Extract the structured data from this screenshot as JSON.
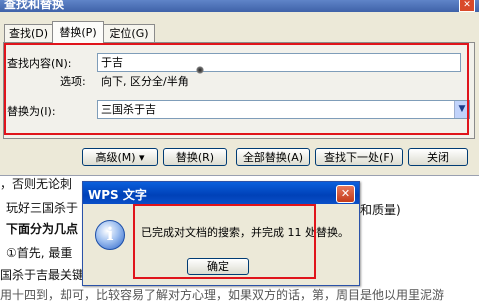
{
  "main_dialog": {
    "title": "查找和替换",
    "tabs": [
      {
        "label": "查找(D)"
      },
      {
        "label": "替换(P)"
      },
      {
        "label": "定位(G)"
      }
    ],
    "find": {
      "label": "查找内容(N):",
      "value": "于吉"
    },
    "options": {
      "label": "选项:",
      "value": "向下, 区分全/半角"
    },
    "replace": {
      "label": "替换为(I):",
      "value": "三国杀于吉"
    },
    "buttons": {
      "more": "高级(M) ▾",
      "replace": "替换(R)",
      "replace_all": "全部替换(A)",
      "find_next": "查找下一处(F)",
      "close": "关闭"
    }
  },
  "document": {
    "lines": [
      "，否则无论刺",
      "玩好三国杀于",
      "和质量)",
      "下面分为几点",
      "①首先, 最重",
      "国杀于吉最关键",
      "用十四到，却可，比较容易了解对方心理，如果双方的话，第，周目是他以用里泥游"
    ]
  },
  "message_box": {
    "title": "WPS 文字",
    "text": "已完成对文档的搜索，并完成 11 处替换。",
    "ok": "确定"
  }
}
